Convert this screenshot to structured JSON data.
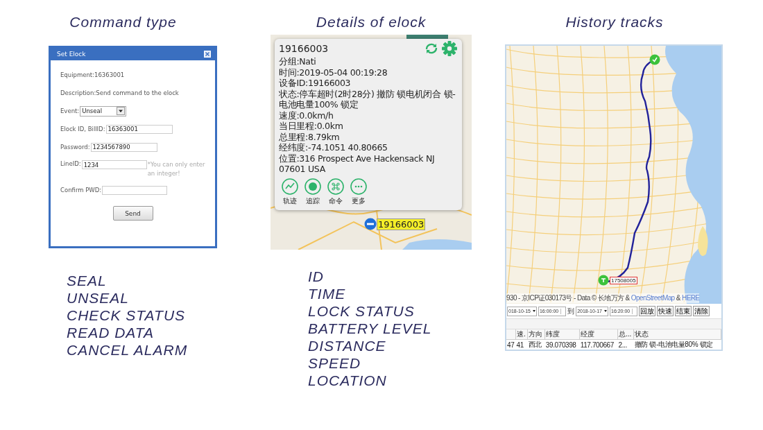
{
  "command_panel": {
    "heading": "Command type",
    "dialog": {
      "title": "Set Elock",
      "equipment": "Equipment:16363001",
      "description": "Description:Send command to the elock",
      "event_label": "Event:",
      "event_value": "Unseal",
      "elock_label": "Elock ID, BillID:",
      "elock_value": "16363001",
      "password_label": "Password:",
      "password_value": "1234567890",
      "line_label": "LineID:",
      "line_value": "1234",
      "hint": "*You can only enter an integer!",
      "confirm_label": "Confirm PWD:",
      "button": "Send"
    },
    "features": [
      "SEAL",
      "UNSEAL",
      "CHECK STATUS",
      "READ DATA",
      "CANCEL ALARM"
    ]
  },
  "details_panel": {
    "heading": "Details of elock",
    "popup": {
      "id": "19166003",
      "lines": [
        "分组:Nati",
        "时间:2019-05-04 00:19:28",
        "设备ID:19166003",
        "状态:停车超时(2时28分) 撤防 锁电机闭合 锁-电池电量100% 锁定",
        "速度:0.0km/h",
        "当日里程:0.0km",
        "总里程:8.79km",
        "经纬度:-74.1051  40.80665",
        "位置:316 Prospect Ave  Hackensack  NJ 07601  USA"
      ],
      "actions": [
        {
          "kind": "track",
          "label": "轨迹"
        },
        {
          "kind": "follow",
          "label": "追踪"
        },
        {
          "kind": "command",
          "label": "命令"
        },
        {
          "kind": "more",
          "label": "更多"
        }
      ]
    },
    "marker_label": "19166003",
    "features": [
      "ID",
      "TIME",
      "LOCK STATUS",
      "BATTERY LEVEL",
      "DISTANCE",
      "SPEED",
      "LOCATION"
    ]
  },
  "history_panel": {
    "heading": "History tracks",
    "marker_label": "17508005",
    "attribution": [
      {
        "kind": "text",
        "text": "930 - 京ICP证030173号 - Data © 长地万方 &"
      },
      {
        "kind": "link",
        "text": "OpenStreetMap"
      },
      {
        "kind": "text",
        "text": "&"
      },
      {
        "kind": "link",
        "text": "HERE"
      }
    ],
    "toolbar": {
      "start_date": "018-10-15",
      "start_time": "16:00:00",
      "to_label": "到",
      "end_date": "2018-10-17",
      "end_time": "16:20:00",
      "buttons": [
        "回放",
        "快速",
        "结束",
        "清除"
      ]
    },
    "table": {
      "columns": [
        "",
        "速.",
        "方向",
        "纬度",
        "经度",
        "总...",
        "状态"
      ],
      "rows": [
        [
          "47",
          "41",
          "西北",
          "39.070398",
          "117.700667",
          "2...",
          "撤防 锁-电池电量80% 锁定"
        ]
      ]
    }
  }
}
